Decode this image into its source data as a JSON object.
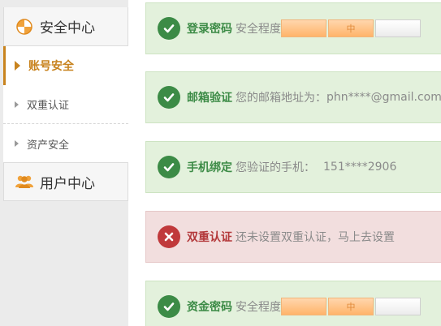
{
  "sidebar": {
    "security_center": "安全中心",
    "items": [
      {
        "label": "账号安全"
      },
      {
        "label": "双重认证"
      },
      {
        "label": "资产安全"
      }
    ],
    "user_center": "用户中心"
  },
  "cards": [
    {
      "title": "登录密码",
      "desc": "安全程度",
      "level_label": "中",
      "status": "ok"
    },
    {
      "title": "邮箱验证",
      "desc": "您的邮箱地址为：",
      "value": "phn****@gmail.com",
      "status": "ok"
    },
    {
      "title": "手机绑定",
      "desc": "您验证的手机：",
      "value": "151****2906",
      "status": "ok"
    },
    {
      "title": "双重认证",
      "desc": "还未设置双重认证，马上去设置",
      "status": "bad"
    },
    {
      "title": "资金密码",
      "desc": "安全程度",
      "level_label": "中",
      "status": "ok"
    }
  ],
  "colors": {
    "accent": "#c8831e",
    "ok_green": "#3c8b46",
    "ok_bg": "#e3f1dc",
    "bad_red": "#c0393b",
    "bad_bg": "#f2dede"
  }
}
